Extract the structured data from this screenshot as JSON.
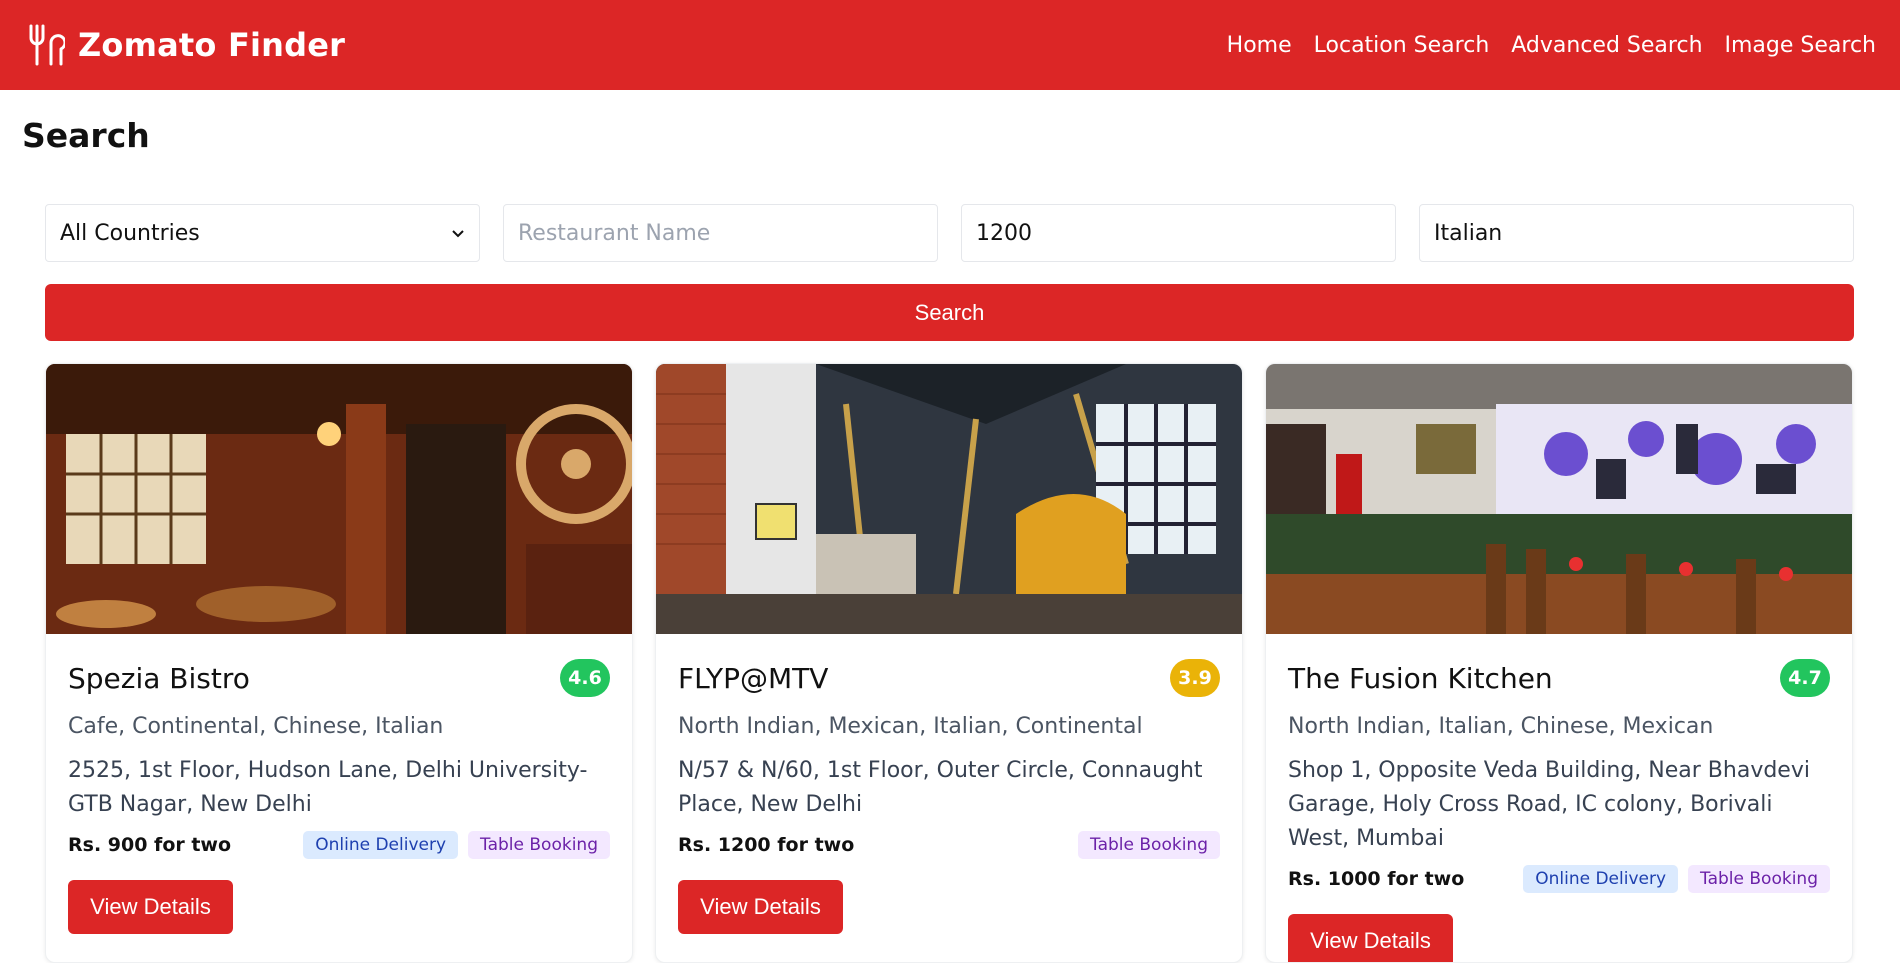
{
  "colors": {
    "brand": "#dc2626",
    "rating_green": "#22c55e",
    "rating_yellow": "#eab308"
  },
  "header": {
    "title": "Zomato Finder",
    "nav": [
      "Home",
      "Location Search",
      "Advanced Search",
      "Image Search"
    ]
  },
  "page": {
    "title": "Search"
  },
  "filters": {
    "country": "All Countries",
    "restaurant_placeholder": "Restaurant Name",
    "cost": "1200",
    "cuisine": "Italian"
  },
  "search_button": "Search",
  "restaurants": [
    {
      "name": "Spezia Bistro",
      "rating": "4.6",
      "rating_color": "#22c55e",
      "cuisines": "Cafe, Continental, Chinese, Italian",
      "address": "2525, 1st Floor, Hudson Lane, Delhi University-GTB Nagar, New Delhi",
      "price": "Rs. 900 for two",
      "tags": [
        "Online Delivery",
        "Table Booking"
      ],
      "button": "View Details"
    },
    {
      "name": "FLYP@MTV",
      "rating": "3.9",
      "rating_color": "#eab308",
      "cuisines": "North Indian, Mexican, Italian, Continental",
      "address": "N/57 & N/60, 1st Floor, Outer Circle, Connaught Place, New Delhi",
      "price": "Rs. 1200 for two",
      "tags": [
        "Table Booking"
      ],
      "button": "View Details"
    },
    {
      "name": "The Fusion Kitchen",
      "rating": "4.7",
      "rating_color": "#22c55e",
      "cuisines": "North Indian, Italian, Chinese, Mexican",
      "address": "Shop 1, Opposite Veda Building, Near Bhavdevi Garage, Holy Cross Road, IC colony, Borivali West, Mumbai",
      "price": "Rs. 1000 for two",
      "tags": [
        "Online Delivery",
        "Table Booking"
      ],
      "button": "View Details"
    }
  ]
}
